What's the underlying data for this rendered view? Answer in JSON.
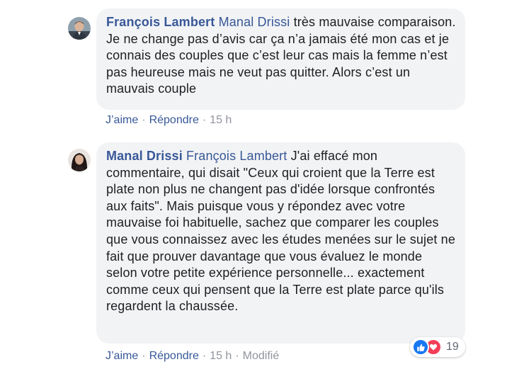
{
  "comments": [
    {
      "author": "François Lambert",
      "mention": "Manal Drissi",
      "text": "très mauvaise comparaison. Je ne change pas d’avis car ça n’a jamais été mon cas et je connais des couples que c’est leur cas mais la femme n’est pas heureuse mais ne veut pas quitter. Alors c’est un mauvais couple",
      "actions": {
        "like": "J’aime",
        "reply": "Répondre",
        "time": "15 h"
      }
    },
    {
      "author": "Manal Drissi",
      "mention": "François Lambert",
      "text": "J'ai effacé mon commentaire, qui disait \"Ceux qui croient que la Terre est plate non plus ne changent pas d'idée lorsque confrontés aux faits\". Mais puisque vous y répondez avec votre mauvaise foi habituelle, sachez que comparer les couples que vous connaissez avec les études menées sur le sujet ne fait que prouver davantage que vous évaluez le monde selon votre petite expérience personnelle... exactement comme ceux qui pensent que la Terre est plate parce qu'ils regardent la chaussée.",
      "actions": {
        "like": "J’aime",
        "reply": "Répondre",
        "time": "15 h",
        "edited": "Modifié"
      },
      "reactions": {
        "icons": [
          "like-icon",
          "love-icon"
        ],
        "count": "19"
      }
    }
  ],
  "colors": {
    "link": "#385898",
    "text": "#1c1e21",
    "bubble": "#f2f3f5",
    "meta": "#90949c",
    "like": "#1877f2",
    "love": "#f33e58"
  }
}
